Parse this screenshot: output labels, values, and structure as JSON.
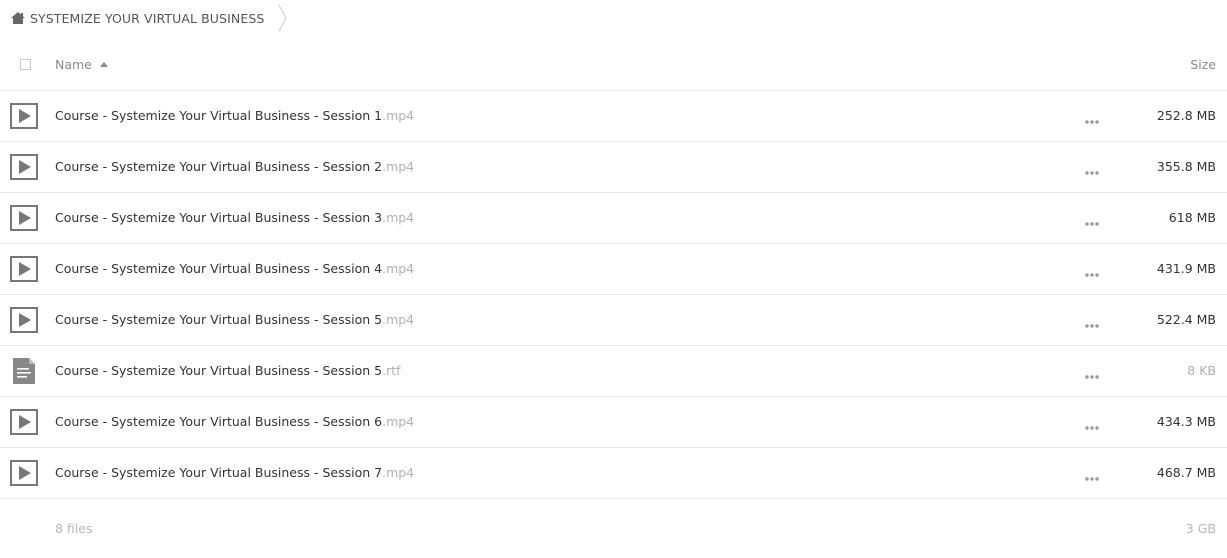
{
  "breadcrumb": {
    "home_icon": "home-icon",
    "folder": "SYSTEMIZE YOUR VIRTUAL BUSINESS"
  },
  "header": {
    "name_label": "Name",
    "size_label": "Size",
    "sort_icon": "sort-ascending-icon"
  },
  "files": [
    {
      "base": "Course - Systemize Your Virtual Business - Session 1",
      "ext": ".mp4",
      "size": "252.8 MB",
      "icon": "video-play-icon"
    },
    {
      "base": "Course - Systemize Your Virtual Business - Session 2",
      "ext": ".mp4",
      "size": "355.8 MB",
      "icon": "video-play-icon"
    },
    {
      "base": "Course - Systemize Your Virtual Business - Session 3",
      "ext": ".mp4",
      "size": "618 MB",
      "icon": "video-play-icon"
    },
    {
      "base": "Course - Systemize Your Virtual Business - Session 4",
      "ext": ".mp4",
      "size": "431.9 MB",
      "icon": "video-play-icon"
    },
    {
      "base": "Course - Systemize Your Virtual Business - Session 5",
      "ext": ".mp4",
      "size": "522.4 MB",
      "icon": "video-play-icon"
    },
    {
      "base": "Course - Systemize Your Virtual Business - Session 5",
      "ext": ".rtf",
      "size": "8 KB",
      "icon": "document-icon"
    },
    {
      "base": "Course - Systemize Your Virtual Business - Session 6",
      "ext": ".mp4",
      "size": "434.3 MB",
      "icon": "video-play-icon"
    },
    {
      "base": "Course - Systemize Your Virtual Business - Session 7",
      "ext": ".mp4",
      "size": "468.7 MB",
      "icon": "video-play-icon"
    }
  ],
  "footer": {
    "count": "8 files",
    "total": "3 GB"
  },
  "colors": {
    "text": "#333333",
    "muted": "#b0b0b0",
    "icon": "#777777",
    "divider": "#e9e9e9"
  }
}
